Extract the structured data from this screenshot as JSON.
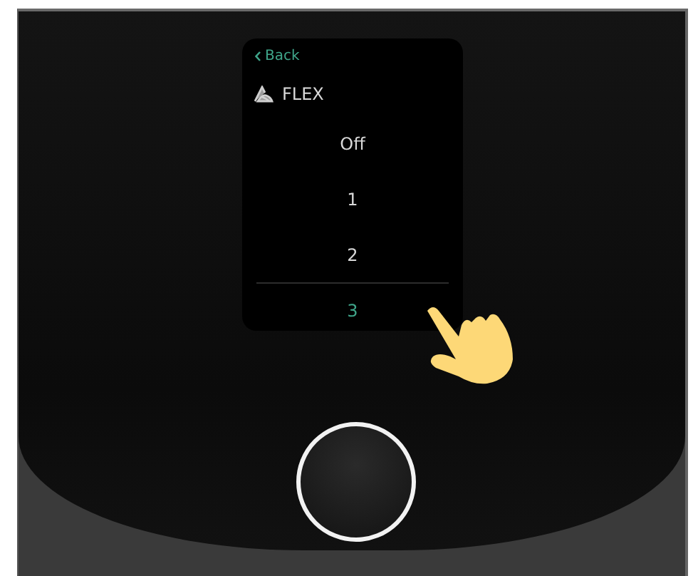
{
  "screen": {
    "back_label": "Back",
    "title": "FLEX",
    "options": [
      {
        "label": "Off",
        "selected": false
      },
      {
        "label": "1",
        "selected": false
      },
      {
        "label": "2",
        "selected": false
      },
      {
        "label": "3",
        "selected": true
      }
    ]
  }
}
